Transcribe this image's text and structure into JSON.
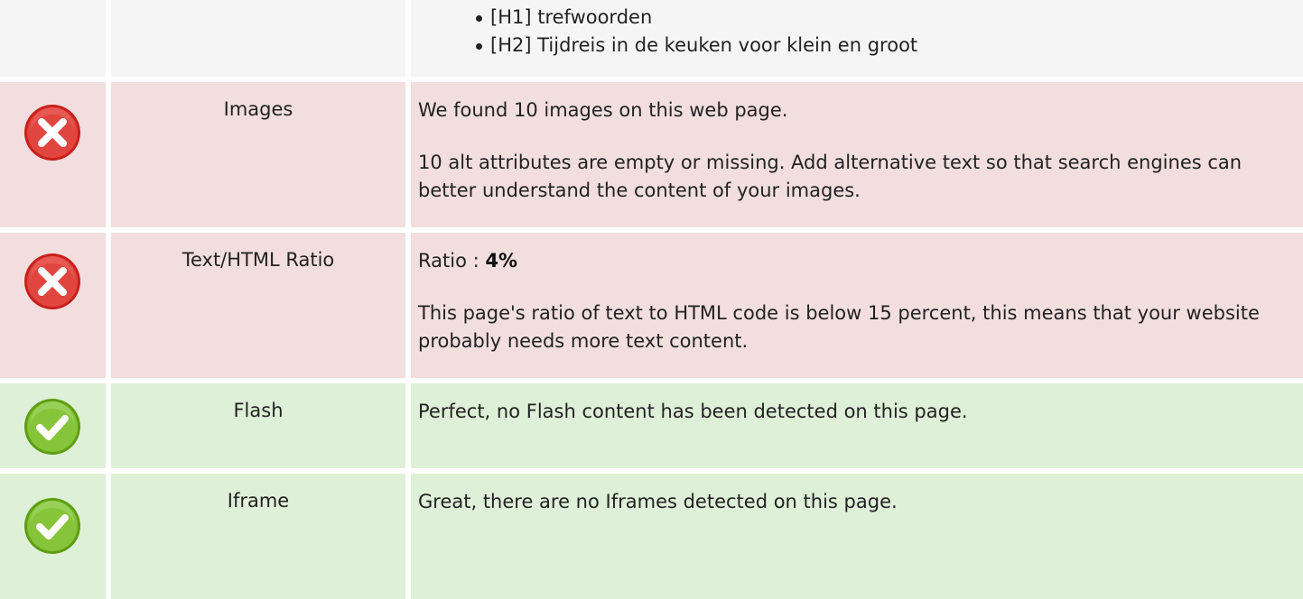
{
  "headings_row": {
    "items": [
      "[H1] trefwoorden",
      "[H2] Tijdreis in de keuken voor klein en groot"
    ]
  },
  "rows": [
    {
      "label": "Images",
      "status": "error",
      "icon": "error-icon",
      "paragraphs": [
        "We found 10 images on this web page.",
        "10 alt attributes are empty or missing. Add alternative text so that search engines can better understand the content of your images."
      ]
    },
    {
      "label": "Text/HTML Ratio",
      "status": "error",
      "icon": "error-icon",
      "ratio_prefix": "Ratio : ",
      "ratio_value": "4%",
      "paragraphs": [
        "This page's ratio of text to HTML code is below 15 percent, this means that your website probably needs more text content."
      ]
    },
    {
      "label": "Flash",
      "status": "success",
      "icon": "success-icon",
      "paragraphs": [
        "Perfect, no Flash content has been detected on this page."
      ]
    },
    {
      "label": "Iframe",
      "status": "success",
      "icon": "success-icon",
      "paragraphs": [
        "Great, there are no Iframes detected on this page."
      ]
    }
  ],
  "colors": {
    "error_bg": "#f2dede",
    "success_bg": "#dff0d8",
    "neutral_bg": "#f5f5f5",
    "error_icon": "#d9302c",
    "success_icon": "#7cbf2a"
  }
}
